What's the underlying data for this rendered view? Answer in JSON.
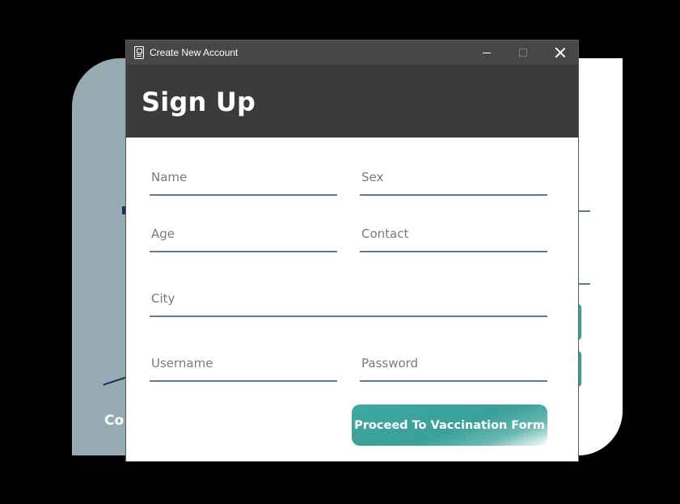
{
  "window": {
    "title": "Create New Account",
    "icon": "app-form-icon"
  },
  "header": {
    "title": "Sign Up"
  },
  "form": {
    "name": {
      "placeholder": "Name",
      "value": ""
    },
    "sex": {
      "placeholder": "Sex",
      "value": ""
    },
    "age": {
      "placeholder": "Age",
      "value": ""
    },
    "contact": {
      "placeholder": "Contact",
      "value": ""
    },
    "city": {
      "placeholder": "City",
      "value": ""
    },
    "username": {
      "placeholder": "Username",
      "value": ""
    },
    "password": {
      "placeholder": "Password",
      "value": ""
    },
    "submit_label": "Proceed To Vaccination Form"
  },
  "background_window": {
    "partial_text": "Co"
  },
  "colors": {
    "header_bg": "#3c3b3a",
    "titlebar_bg": "#474747",
    "underline": "#5f7f8c",
    "button_teal": "#3fa8a1",
    "background_panel": "#98aab1"
  }
}
